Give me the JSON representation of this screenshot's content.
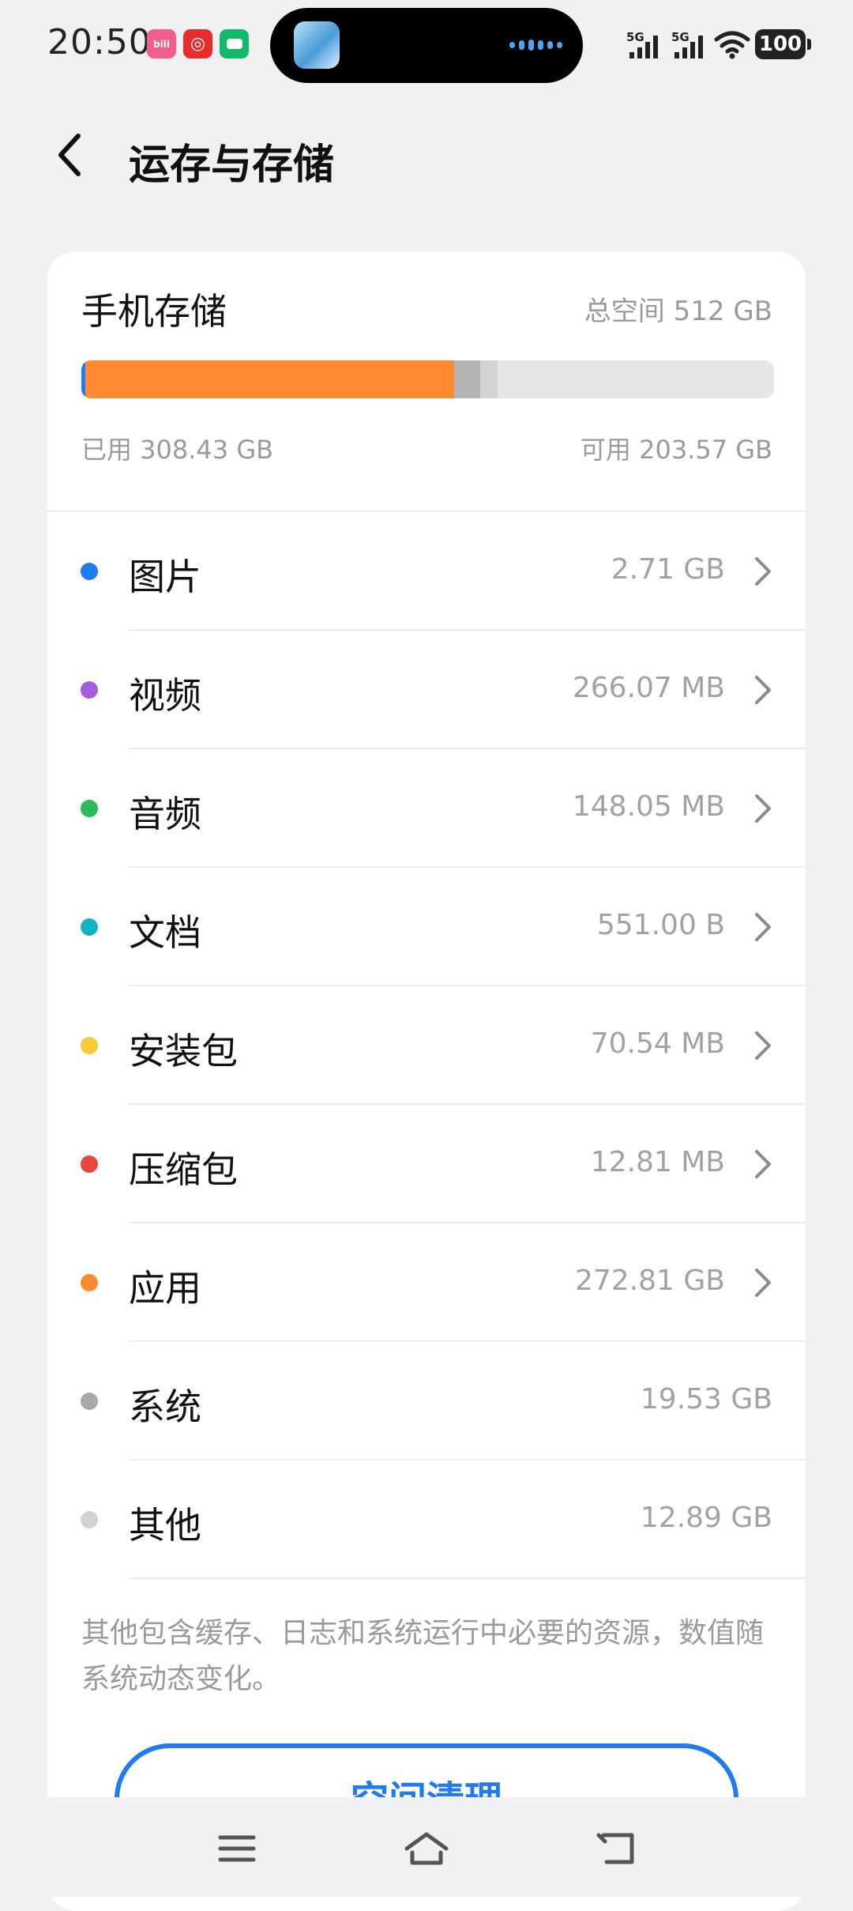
{
  "status_bar": {
    "time": "20:50",
    "apps": [
      {
        "icon": "bilibili-icon",
        "color": "#f25d8e",
        "glyph": "bili"
      },
      {
        "icon": "netease-music-icon",
        "color": "#e72d2c",
        "glyph": "◎"
      },
      {
        "icon": "chat-app-icon",
        "color": "#14b86b",
        "glyph": "▭"
      }
    ],
    "signal_1": "5G",
    "signal_2": "5G",
    "battery": "100"
  },
  "header": {
    "back_icon": "chevron-left-icon",
    "title": "运存与存储"
  },
  "storage": {
    "title": "手机存储",
    "total": "总空间 512 GB",
    "used": "已用 308.43 GB",
    "available": "可用 203.57 GB",
    "used_fraction": 0.6024,
    "bar_segments": [
      {
        "name": "images",
        "fraction": 0.0053,
        "color": "#1e7bf0"
      },
      {
        "name": "apps",
        "fraction": 0.5328,
        "color": "#ff8a30"
      },
      {
        "name": "system",
        "fraction": 0.0381,
        "color": "#b3b3b3"
      },
      {
        "name": "other",
        "fraction": 0.0252,
        "color": "#d2d2d2"
      }
    ]
  },
  "categories": [
    {
      "label": "图片",
      "size": "2.71 GB",
      "color": "#1e7bf0",
      "chevron": true
    },
    {
      "label": "视频",
      "size": "266.07 MB",
      "color": "#a45ddb",
      "chevron": true
    },
    {
      "label": "音频",
      "size": "148.05 MB",
      "color": "#2dbb57",
      "chevron": true
    },
    {
      "label": "文档",
      "size": "551.00 B",
      "color": "#13b3c2",
      "chevron": true
    },
    {
      "label": "安装包",
      "size": "70.54 MB",
      "color": "#f5cc35",
      "chevron": true
    },
    {
      "label": "压缩包",
      "size": "12.81 MB",
      "color": "#e8473f",
      "chevron": true
    },
    {
      "label": "应用",
      "size": "272.81 GB",
      "color": "#ff8a30",
      "chevron": true
    },
    {
      "label": "系统",
      "size": "19.53 GB",
      "color": "#a8a8a8",
      "chevron": false
    },
    {
      "label": "其他",
      "size": "12.89 GB",
      "color": "#d2d2d2",
      "chevron": false
    }
  ],
  "note": "其他包含缓存、日志和系统运行中必要的资源，数值随系统动态变化。",
  "clean_button": "空间清理",
  "nav": {
    "menu_icon": "menu-icon",
    "home_icon": "home-icon",
    "back_icon": "back-icon"
  }
}
